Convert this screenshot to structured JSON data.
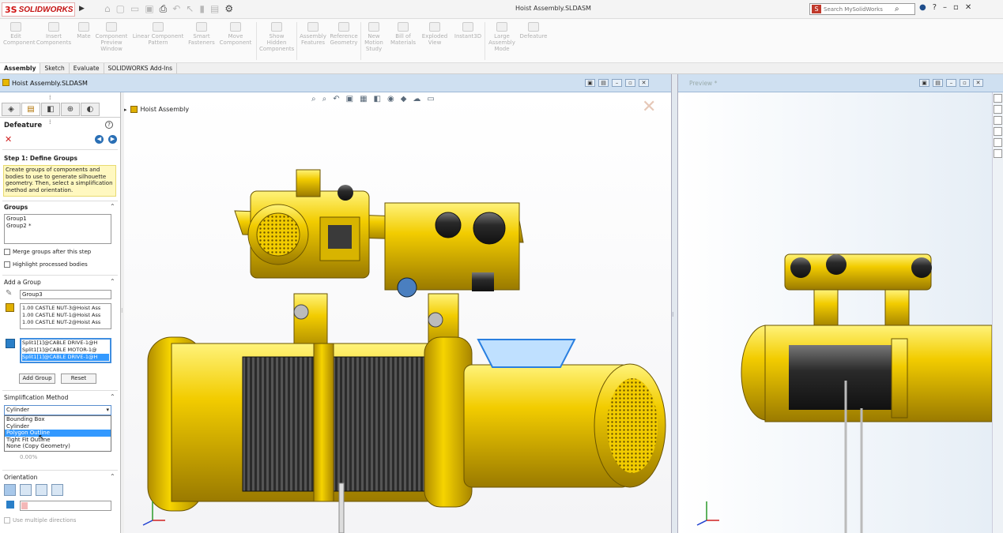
{
  "app": {
    "logo_mark": "3S",
    "logo_text": "SOLIDWORKS",
    "document_title": "Hoist Assembly.SLDASM",
    "search_placeholder": "Search MySolidWorks",
    "help_label": "?"
  },
  "ribbon": {
    "items": [
      {
        "label": "Edit Component"
      },
      {
        "label": "Insert Components"
      },
      {
        "label": "Mate"
      },
      {
        "label": "Component Preview Window"
      },
      {
        "label": "Linear Component Pattern"
      },
      {
        "label": "Smart Fasteners"
      },
      {
        "label": "Move Component"
      },
      {
        "label": "Show Hidden Components"
      },
      {
        "label": "Assembly Features"
      },
      {
        "label": "Reference Geometry"
      },
      {
        "label": "New Motion Study"
      },
      {
        "label": "Bill of Materials"
      },
      {
        "label": "Exploded View"
      },
      {
        "label": "Instant3D"
      },
      {
        "label": "Large Assembly Mode"
      },
      {
        "label": "Defeature"
      }
    ]
  },
  "command_tabs": [
    "Assembly",
    "Sketch",
    "Evaluate",
    "SOLIDWORKS Add-Ins"
  ],
  "document_window": {
    "title": "Hoist Assembly.SLDASM",
    "preview_title": "Preview *"
  },
  "property_manager": {
    "title": "Defeature",
    "help_label": "?",
    "step1": {
      "heading": "Step 1: Define Groups",
      "message": "Create groups of components and bodies to use to generate silhouette geometry. Then, select a simplification method and orientation."
    },
    "groups": {
      "heading": "Groups",
      "items": [
        "Group1",
        "Group2 *"
      ]
    },
    "merge_label": "Merge groups after this step",
    "highlight_label": "Highlight processed bodies",
    "add_group": {
      "heading": "Add a Group",
      "name_value": "Group3",
      "components": [
        "1.00 CASTLE NUT-3@Hoist Ass",
        "1.00 CASTLE NUT-1@Hoist Ass",
        "1.00 CASTLE NUT-2@Hoist Ass"
      ],
      "bodies": [
        "Split1[1]@CABLE DRIVE-1@H",
        "Split1[1]@CABLE MOTOR-1@",
        "Split1[1]@CABLE DRIVE-1@H"
      ],
      "add_button": "Add Group",
      "reset_button": "Reset"
    },
    "simplification": {
      "heading": "Simplification Method",
      "selected": "Cylinder",
      "options": [
        "Bounding Box",
        "Cylinder",
        "Polygon Outline",
        "Tight Fit Outline",
        "None (Copy Geometry)"
      ],
      "highlighted_index": 2,
      "percent_value": "0.00%"
    },
    "orientation": {
      "heading": "Orientation",
      "multiple_directions_label": "Use multiple directions"
    }
  },
  "viewport": {
    "tree_label": "Hoist Assembly"
  },
  "colors": {
    "model_yellow": "#f2cc00",
    "model_dark": "#2b2b2b",
    "selection_blue": "#3399ff",
    "doc_bar": "#cfe0f1"
  }
}
